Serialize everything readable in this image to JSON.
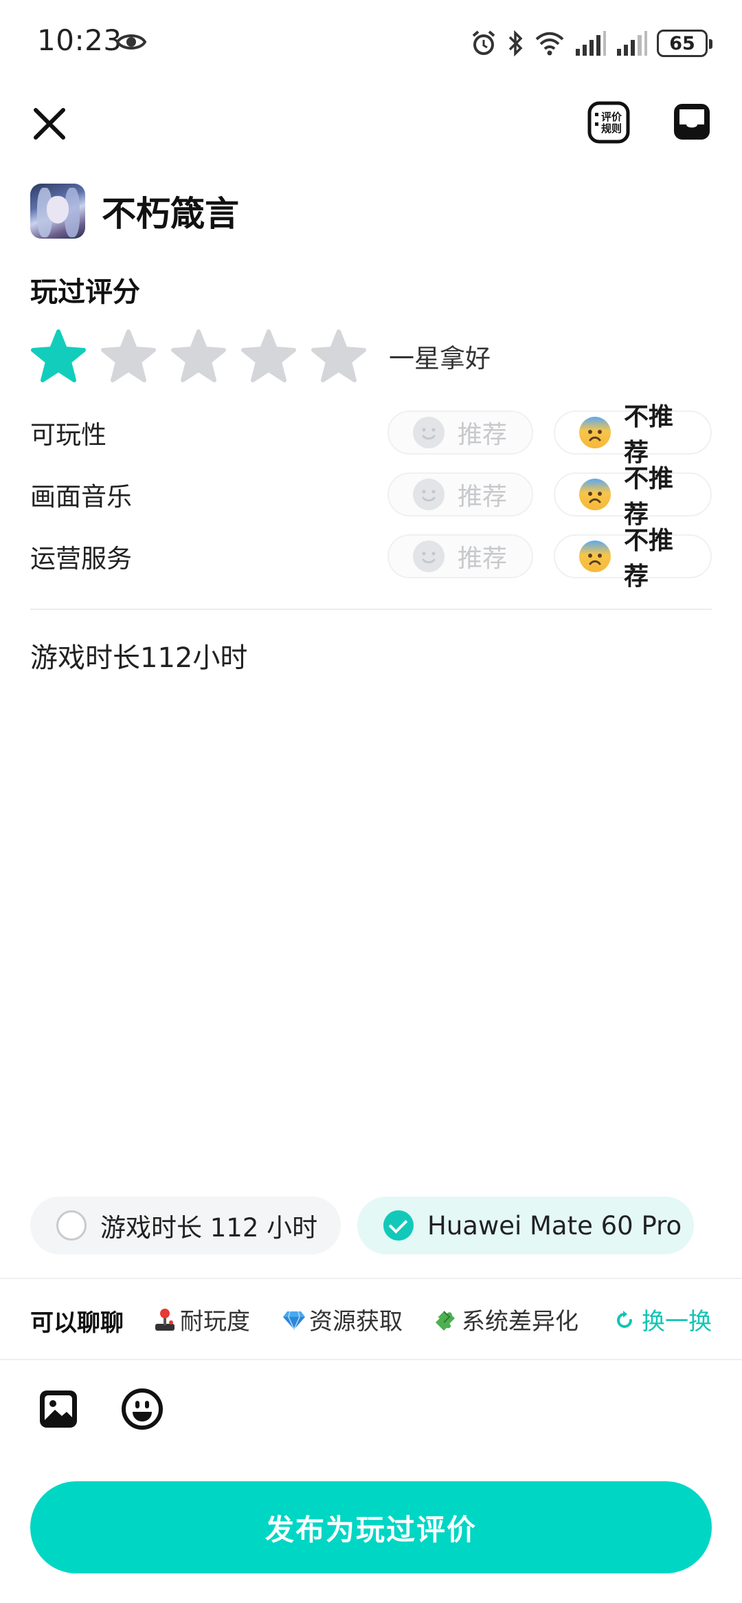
{
  "status_bar": {
    "time": "10:23",
    "battery": "65"
  },
  "nav": {
    "close_icon": "close-icon",
    "rules_icon": "rating-rules-icon",
    "rules_text_1": "评价",
    "rules_text_2": "规则",
    "inbox_icon": "inbox-icon"
  },
  "game": {
    "name": "不朽箴言",
    "icon": "game-avatar"
  },
  "rating": {
    "title": "玩过评分",
    "stars": 1,
    "max_stars": 5,
    "star_label": "一星拿好",
    "criteria": [
      {
        "label": "可玩性",
        "recommend": "推荐",
        "not_recommend": "不推荐",
        "selected": "not_recommend"
      },
      {
        "label": "画面音乐",
        "recommend": "推荐",
        "not_recommend": "不推荐",
        "selected": "not_recommend"
      },
      {
        "label": "运营服务",
        "recommend": "推荐",
        "not_recommend": "不推荐",
        "selected": "not_recommend"
      }
    ]
  },
  "review": {
    "text": "游戏时长112小时"
  },
  "tags": [
    {
      "label": "游戏时长 112 小时",
      "checked": false
    },
    {
      "label": "Huawei Mate 60 Pro",
      "checked": true
    }
  ],
  "topics": {
    "title": "可以聊聊",
    "items": [
      {
        "label": "耐玩度",
        "icon": "joystick-icon"
      },
      {
        "label": "资源获取",
        "icon": "diamond-icon"
      },
      {
        "label": "系统差异化",
        "icon": "puzzle-icon"
      }
    ],
    "refresh": "换一换"
  },
  "toolbar": {
    "image_icon": "image-icon",
    "emoji_icon": "emoji-icon"
  },
  "publish": {
    "label": "发布为玩过评价"
  },
  "colors": {
    "accent": "#00d6c4",
    "star_on": "#12cdbc",
    "star_off": "#d4d6da"
  }
}
